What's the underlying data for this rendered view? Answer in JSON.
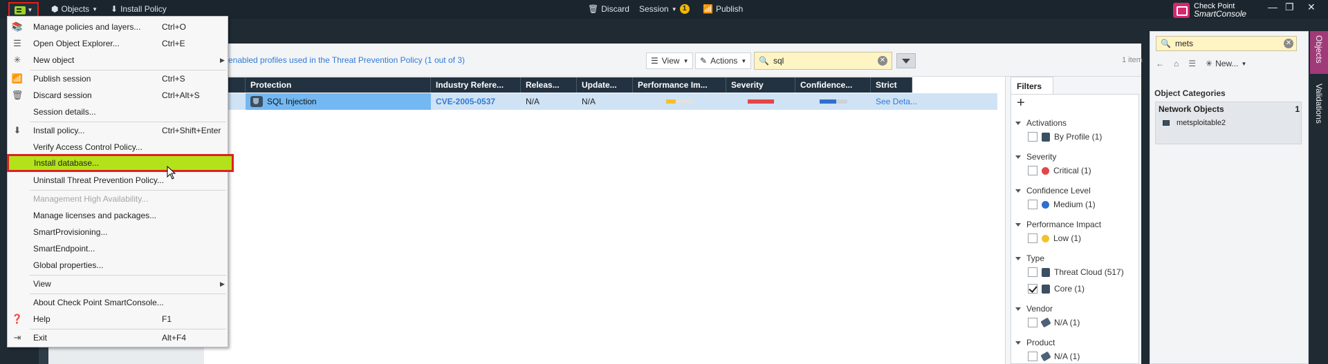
{
  "topbar": {
    "objects_label": "Objects",
    "install_policy_label": "Install Policy",
    "discard_label": "Discard",
    "session_label": "Session",
    "session_count": "1",
    "publish_label": "Publish",
    "brand_line1": "Check Point",
    "brand_line2": "SmartConsole"
  },
  "toolbar": {
    "profiles_link": "enabled profiles used in the Threat Prevention Policy (1 out of 3)",
    "view_label": "View",
    "actions_label": "Actions",
    "search_value": "sql",
    "item_count": "1 item"
  },
  "table": {
    "columns": [
      "Protection",
      "Industry Refere...",
      "Releas...",
      "Update...",
      "Performance Im...",
      "Severity",
      "Confidence...",
      "Strict"
    ],
    "row": {
      "protection": "SQL Injection",
      "industry_ref": "CVE-2005-0537",
      "release": "N/A",
      "update": "N/A",
      "strict": "See Deta..."
    }
  },
  "filters": {
    "tab_label": "Filters",
    "groups": [
      {
        "label": "Activations",
        "options": [
          {
            "label": "By Profile (1)"
          }
        ]
      },
      {
        "label": "Severity",
        "options": [
          {
            "label": "Critical (1)"
          }
        ]
      },
      {
        "label": "Confidence Level",
        "options": [
          {
            "label": "Medium (1)"
          }
        ]
      },
      {
        "label": "Performance Impact",
        "options": [
          {
            "label": "Low (1)"
          }
        ]
      },
      {
        "label": "Type",
        "options": [
          {
            "label": "Threat Cloud (517)"
          },
          {
            "label": "Core (1)"
          }
        ]
      },
      {
        "label": "Vendor",
        "options": [
          {
            "label": "N/A (1)"
          }
        ]
      },
      {
        "label": "Product",
        "options": [
          {
            "label": "N/A (1)"
          }
        ]
      }
    ]
  },
  "right_panel": {
    "search_value": "mets",
    "new_label": "New...",
    "categories_title": "Object Categories",
    "network_objects_label": "Network Objects",
    "network_objects_count": "1",
    "entry": "metsploitable2"
  },
  "side_tabs": [
    "Objects",
    "Validations"
  ],
  "menu": {
    "items": [
      {
        "label": "Manage policies and layers...",
        "shortcut": "Ctrl+O"
      },
      {
        "label": "Open Object Explorer...",
        "shortcut": "Ctrl+E"
      },
      {
        "label": "New object",
        "shortcut": ""
      },
      {
        "label": "Publish session",
        "shortcut": "Ctrl+S"
      },
      {
        "label": "Discard session",
        "shortcut": "Ctrl+Alt+S"
      },
      {
        "label": "Session details...",
        "shortcut": ""
      },
      {
        "label": "Install policy...",
        "shortcut": "Ctrl+Shift+Enter"
      },
      {
        "label": "Verify Access Control Policy...",
        "shortcut": ""
      },
      {
        "label": "Install database...",
        "shortcut": ""
      },
      {
        "label": "Uninstall Threat Prevention Policy...",
        "shortcut": ""
      },
      {
        "label": "Management High Availability...",
        "shortcut": ""
      },
      {
        "label": "Manage licenses and packages...",
        "shortcut": ""
      },
      {
        "label": "SmartProvisioning...",
        "shortcut": ""
      },
      {
        "label": "SmartEndpoint...",
        "shortcut": ""
      },
      {
        "label": "Global properties...",
        "shortcut": ""
      },
      {
        "label": "View",
        "shortcut": ""
      },
      {
        "label": "About Check Point SmartConsole...",
        "shortcut": ""
      },
      {
        "label": "Help",
        "shortcut": "F1"
      },
      {
        "label": "Exit",
        "shortcut": "Alt+F4"
      }
    ]
  },
  "colors": {
    "menu_highlight": "#b3e21a",
    "highlight_border": "#e02020",
    "topbar": "#1b252e",
    "selected_cell": "#73b8f2"
  }
}
